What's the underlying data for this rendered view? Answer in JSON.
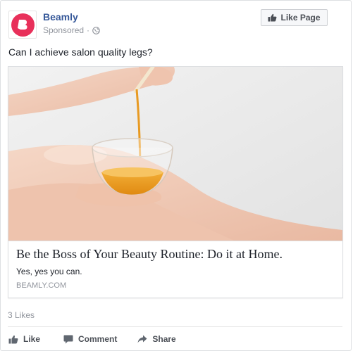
{
  "post": {
    "page_name": "Beamly",
    "sponsored_label": "Sponsored",
    "separator": "·",
    "like_page_label": "Like Page",
    "message": "Can I achieve salon quality legs?"
  },
  "link": {
    "title": "Be the Boss of Your Beauty Routine: Do it at Home.",
    "description": "Yes, yes you can.",
    "domain": "BEAMLY.COM"
  },
  "stats": {
    "likes": "3 Likes"
  },
  "actions": {
    "like": "Like",
    "comment": "Comment",
    "share": "Share"
  },
  "colors": {
    "brand": "#e8305a",
    "link_blue": "#365899",
    "muted": "#90949c"
  }
}
